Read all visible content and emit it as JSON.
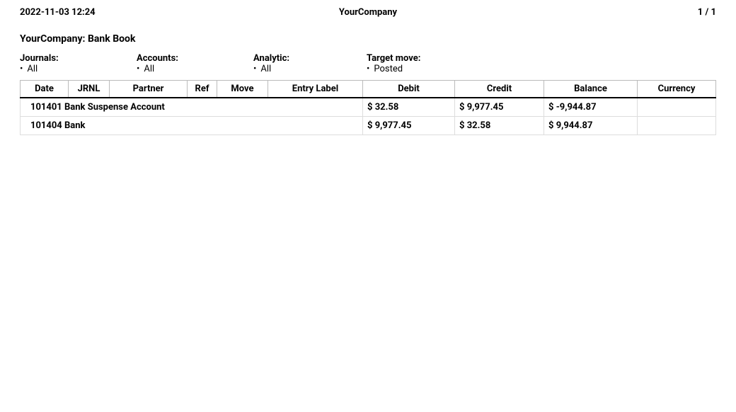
{
  "header": {
    "datetime": "2022-11-03 12:24",
    "company": "YourCompany",
    "page_current": "1",
    "page_sep": " / ",
    "page_total": "1"
  },
  "title": "YourCompany: Bank Book",
  "filters": {
    "journals": {
      "label": "Journals:",
      "value": "All"
    },
    "accounts": {
      "label": "Accounts:",
      "value": "All"
    },
    "analytic": {
      "label": "Analytic:",
      "value": "All"
    },
    "target_move": {
      "label": "Target move:",
      "value": "Posted"
    }
  },
  "columns": {
    "date": "Date",
    "jrnl": "JRNL",
    "partner": "Partner",
    "ref": "Ref",
    "move": "Move",
    "entry_label": "Entry Label",
    "debit": "Debit",
    "credit": "Credit",
    "balance": "Balance",
    "currency": "Currency"
  },
  "rows": [
    {
      "account": "101401 Bank Suspense Account",
      "debit": "$ 32.58",
      "credit": "$ 9,977.45",
      "balance": "$ -9,944.87",
      "currency": ""
    },
    {
      "account": "101404 Bank",
      "debit": "$ 9,977.45",
      "credit": "$ 32.58",
      "balance": "$ 9,944.87",
      "currency": ""
    }
  ]
}
